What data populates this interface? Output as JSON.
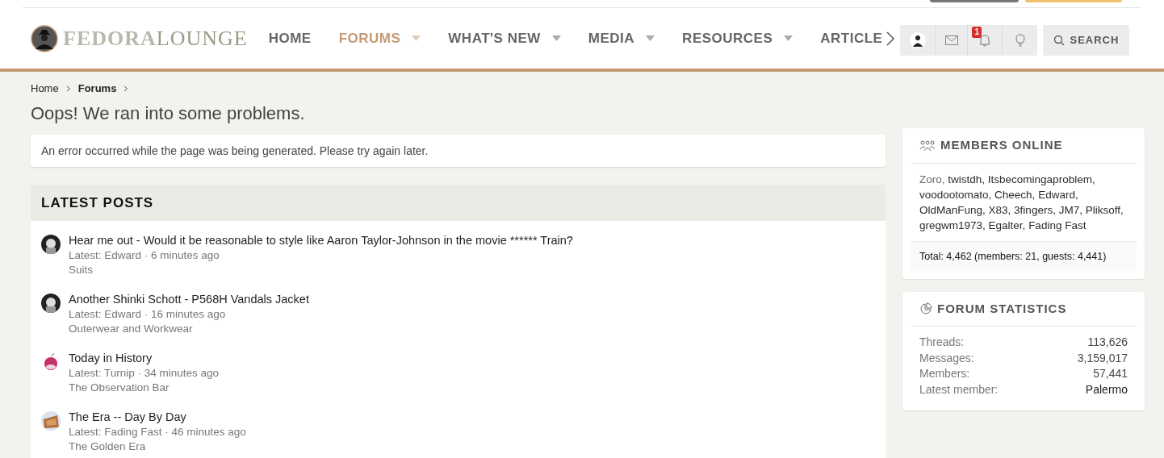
{
  "logo": {
    "part_1": "FEDORA",
    "part_2": "LOUNGE"
  },
  "nav": [
    {
      "label": "HOME",
      "selected": false,
      "dropdown": false
    },
    {
      "label": "FORUMS",
      "selected": true,
      "dropdown": true
    },
    {
      "label": "WHAT'S NEW",
      "selected": false,
      "dropdown": true
    },
    {
      "label": "MEDIA",
      "selected": false,
      "dropdown": true
    },
    {
      "label": "RESOURCES",
      "selected": false,
      "dropdown": true
    },
    {
      "label": "ARTICLE",
      "selected": false,
      "dropdown": false
    }
  ],
  "user_bar": {
    "alerts_badge": "1",
    "search_label": "SEARCH"
  },
  "breadcrumb": [
    {
      "label": "Home",
      "current": false
    },
    {
      "label": "Forums",
      "current": true
    }
  ],
  "page_title": "Oops! We ran into some problems.",
  "error_message": "An error occurred while the page was being generated. Please try again later.",
  "latest_posts": {
    "title": "LATEST POSTS",
    "posts": [
      {
        "title": "Hear me out - Would it be reasonable to style like Aaron Taylor-Johnson in the movie ****** Train?",
        "meta": "Latest: Edward · 6 minutes ago",
        "forum": "Suits"
      },
      {
        "title": "Another Shinki Schott - P568H Vandals Jacket",
        "meta": "Latest: Edward · 16 minutes ago",
        "forum": "Outerwear and Workwear"
      },
      {
        "title": "Today in History",
        "meta": "Latest: Turnip · 34 minutes ago",
        "forum": "The Observation Bar"
      },
      {
        "title": "The Era -- Day By Day",
        "meta": "Latest: Fading Fast · 46 minutes ago",
        "forum": "The Golden Era"
      }
    ]
  },
  "members_online": {
    "title": "MEMBERS ONLINE",
    "members": [
      {
        "name": "Zoro,",
        "color": "#6b6b6b"
      },
      {
        "name": "twistdh,",
        "color": "#2b2b2b"
      },
      {
        "name": "Itsbecomingaproblem,",
        "color": "#2b2b2b"
      },
      {
        "name": "voodootomato,",
        "color": "#2b2b2b"
      },
      {
        "name": "Cheech,",
        "color": "#2b2b2b"
      },
      {
        "name": "Edward,",
        "color": "#2b2b2b"
      },
      {
        "name": "OldManFung,",
        "color": "#2b2b2b"
      },
      {
        "name": "X83,",
        "color": "#2b2b2b"
      },
      {
        "name": "3fingers,",
        "color": "#2b2b2b"
      },
      {
        "name": "JM7,",
        "color": "#2b2b2b"
      },
      {
        "name": "Pliksoff,",
        "color": "#2b2b2b"
      },
      {
        "name": "gregwm1973,",
        "color": "#2b2b2b"
      },
      {
        "name": "Egalter,",
        "color": "#2b2b2b"
      },
      {
        "name": "Fading Fast",
        "color": "#2b2b2b"
      }
    ],
    "total": "Total: 4,462 (members: 21, guests: 4,441)"
  },
  "forum_statistics": {
    "title": "FORUM STATISTICS",
    "rows": [
      {
        "label": "Threads:",
        "value": "113,626"
      },
      {
        "label": "Messages:",
        "value": "3,159,017"
      },
      {
        "label": "Members:",
        "value": "57,441"
      },
      {
        "label": "Latest member:",
        "value": "Palermo"
      }
    ]
  }
}
